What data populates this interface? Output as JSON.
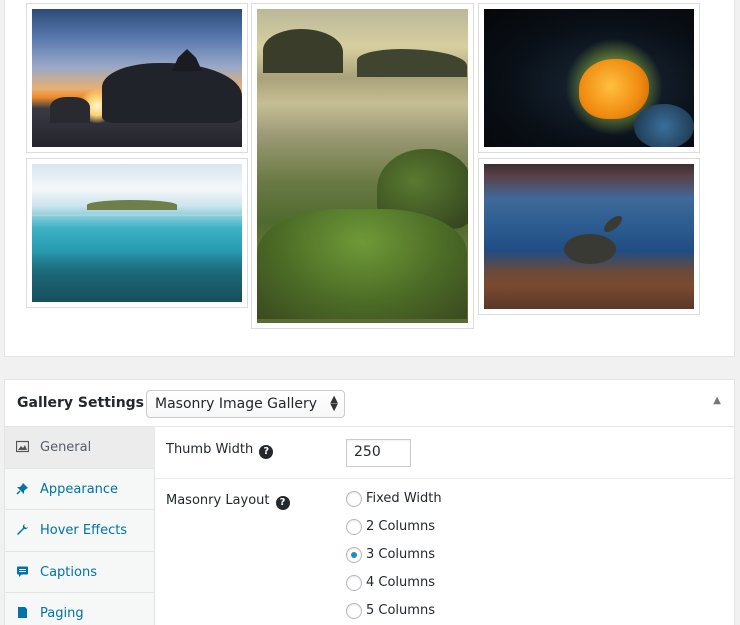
{
  "gallery_preview": {
    "images": [
      {
        "id": "sunset-temple",
        "alt": ""
      },
      {
        "id": "beach-rocks",
        "alt": ""
      },
      {
        "id": "coral",
        "alt": ""
      },
      {
        "id": "half-underwater-island",
        "alt": ""
      },
      {
        "id": "turtle-underwater",
        "alt": ""
      }
    ]
  },
  "settings": {
    "title": "Gallery Settings —",
    "gallery_type": "Masonry Image Gallery",
    "collapse_icon": "triangle-up-icon",
    "tabs": [
      {
        "label": "General",
        "icon": "image-icon",
        "active": true
      },
      {
        "label": "Appearance",
        "icon": "pin-icon",
        "active": false
      },
      {
        "label": "Hover Effects",
        "icon": "wrench-icon",
        "active": false
      },
      {
        "label": "Captions",
        "icon": "comment-icon",
        "active": false
      },
      {
        "label": "Paging",
        "icon": "page-icon",
        "active": false
      }
    ],
    "fields": {
      "thumb_width": {
        "label": "Thumb Width",
        "value": "250"
      },
      "masonry_layout": {
        "label": "Masonry Layout",
        "options": [
          "Fixed Width",
          "2 Columns",
          "3 Columns",
          "4 Columns",
          "5 Columns"
        ],
        "selected": "3 Columns"
      }
    }
  },
  "colors": {
    "link": "#0073aa",
    "radio_checked": "#1e8cbe",
    "panel_bg": "#ffffff",
    "page_bg": "#f1f1f1"
  }
}
